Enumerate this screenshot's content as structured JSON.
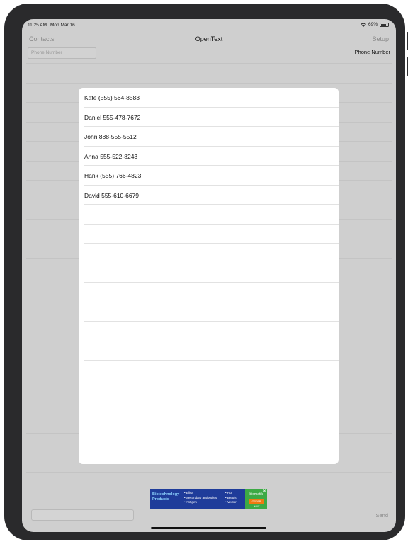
{
  "status_bar": {
    "time": "11:25 AM",
    "date": "Mon Mar 16",
    "battery": "69%",
    "battery_level": 0.69
  },
  "nav": {
    "left_label": "Contacts",
    "title": "OpenText",
    "right_label": "Setup"
  },
  "phone": {
    "placeholder": "Phone Number",
    "label": "Phone Number"
  },
  "contacts_popup": {
    "rows": [
      "Kate (555) 564-8583",
      "Daniel 555-478-7672",
      "John 888-555-5512",
      "Anna 555-522-8243",
      "Hank (555) 766-4823",
      "David 555-610-6679",
      "",
      "",
      "",
      "",
      "",
      "",
      "",
      "",
      "",
      "",
      "",
      "",
      ""
    ]
  },
  "ad": {
    "title_line1": "Biotechnology",
    "title_line2": "Products",
    "col1": [
      "• Elisa",
      "• Secondary antibodies",
      "• Antigen"
    ],
    "col2": [
      "• Pcr",
      "• Beads",
      "• Vector"
    ],
    "brand": "biomatik",
    "cta": "ORDER NOW",
    "close": "✕"
  },
  "composer": {
    "message_placeholder": "",
    "send_label": "Send"
  },
  "colors": {
    "screen_bg": "#cfcfcf",
    "popup_bg": "#ffffff",
    "muted_text": "#8a8a8a",
    "ad_blue": "#1f3c9a",
    "ad_green": "#3daa45"
  }
}
